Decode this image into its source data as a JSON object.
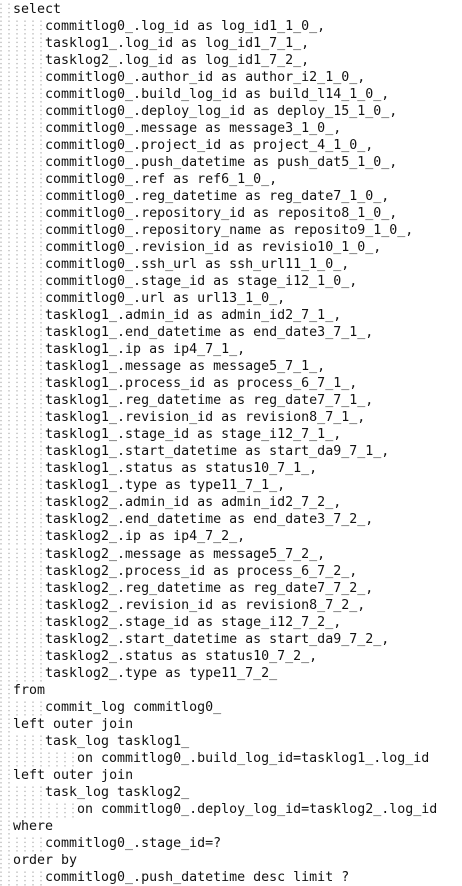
{
  "lines": [
    {
      "indent": 0,
      "text": "select"
    },
    {
      "indent": 1,
      "text": "commitlog0_.log_id as log_id1_1_0_,"
    },
    {
      "indent": 1,
      "text": "tasklog1_.log_id as log_id1_7_1_,"
    },
    {
      "indent": 1,
      "text": "tasklog2_.log_id as log_id1_7_2_,"
    },
    {
      "indent": 1,
      "text": "commitlog0_.author_id as author_i2_1_0_,"
    },
    {
      "indent": 1,
      "text": "commitlog0_.build_log_id as build_l14_1_0_,"
    },
    {
      "indent": 1,
      "text": "commitlog0_.deploy_log_id as deploy_15_1_0_,"
    },
    {
      "indent": 1,
      "text": "commitlog0_.message as message3_1_0_,"
    },
    {
      "indent": 1,
      "text": "commitlog0_.project_id as project_4_1_0_,"
    },
    {
      "indent": 1,
      "text": "commitlog0_.push_datetime as push_dat5_1_0_,"
    },
    {
      "indent": 1,
      "text": "commitlog0_.ref as ref6_1_0_,"
    },
    {
      "indent": 1,
      "text": "commitlog0_.reg_datetime as reg_date7_1_0_,"
    },
    {
      "indent": 1,
      "text": "commitlog0_.repository_id as reposito8_1_0_,"
    },
    {
      "indent": 1,
      "text": "commitlog0_.repository_name as reposito9_1_0_,"
    },
    {
      "indent": 1,
      "text": "commitlog0_.revision_id as revisio10_1_0_,"
    },
    {
      "indent": 1,
      "text": "commitlog0_.ssh_url as ssh_url11_1_0_,"
    },
    {
      "indent": 1,
      "text": "commitlog0_.stage_id as stage_i12_1_0_,"
    },
    {
      "indent": 1,
      "text": "commitlog0_.url as url13_1_0_,"
    },
    {
      "indent": 1,
      "text": "tasklog1_.admin_id as admin_id2_7_1_,"
    },
    {
      "indent": 1,
      "text": "tasklog1_.end_datetime as end_date3_7_1_,"
    },
    {
      "indent": 1,
      "text": "tasklog1_.ip as ip4_7_1_,"
    },
    {
      "indent": 1,
      "text": "tasklog1_.message as message5_7_1_,"
    },
    {
      "indent": 1,
      "text": "tasklog1_.process_id as process_6_7_1_,"
    },
    {
      "indent": 1,
      "text": "tasklog1_.reg_datetime as reg_date7_7_1_,"
    },
    {
      "indent": 1,
      "text": "tasklog1_.revision_id as revision8_7_1_,"
    },
    {
      "indent": 1,
      "text": "tasklog1_.stage_id as stage_i12_7_1_,"
    },
    {
      "indent": 1,
      "text": "tasklog1_.start_datetime as start_da9_7_1_,"
    },
    {
      "indent": 1,
      "text": "tasklog1_.status as status10_7_1_,"
    },
    {
      "indent": 1,
      "text": "tasklog1_.type as type11_7_1_,"
    },
    {
      "indent": 1,
      "text": "tasklog2_.admin_id as admin_id2_7_2_,"
    },
    {
      "indent": 1,
      "text": "tasklog2_.end_datetime as end_date3_7_2_,"
    },
    {
      "indent": 1,
      "text": "tasklog2_.ip as ip4_7_2_,"
    },
    {
      "indent": 1,
      "text": "tasklog2_.message as message5_7_2_,"
    },
    {
      "indent": 1,
      "text": "tasklog2_.process_id as process_6_7_2_,"
    },
    {
      "indent": 1,
      "text": "tasklog2_.reg_datetime as reg_date7_7_2_,"
    },
    {
      "indent": 1,
      "text": "tasklog2_.revision_id as revision8_7_2_,"
    },
    {
      "indent": 1,
      "text": "tasklog2_.stage_id as stage_i12_7_2_,"
    },
    {
      "indent": 1,
      "text": "tasklog2_.start_datetime as start_da9_7_2_,"
    },
    {
      "indent": 1,
      "text": "tasklog2_.status as status10_7_2_,"
    },
    {
      "indent": 1,
      "text": "tasklog2_.type as type11_7_2_"
    },
    {
      "indent": 0,
      "text": "from"
    },
    {
      "indent": 1,
      "text": "commit_log commitlog0_"
    },
    {
      "indent": 0,
      "text": "left outer join"
    },
    {
      "indent": 1,
      "text": "task_log tasklog1_"
    },
    {
      "indent": 2,
      "text": "on commitlog0_.build_log_id=tasklog1_.log_id"
    },
    {
      "indent": 0,
      "text": "left outer join"
    },
    {
      "indent": 1,
      "text": "task_log tasklog2_"
    },
    {
      "indent": 2,
      "text": "on commitlog0_.deploy_log_id=tasklog2_.log_id"
    },
    {
      "indent": 0,
      "text": "where"
    },
    {
      "indent": 1,
      "text": "commitlog0_.stage_id=?"
    },
    {
      "indent": 0,
      "text": "order by"
    },
    {
      "indent": 1,
      "text": "commitlog0_.push_datetime desc limit ?"
    }
  ]
}
